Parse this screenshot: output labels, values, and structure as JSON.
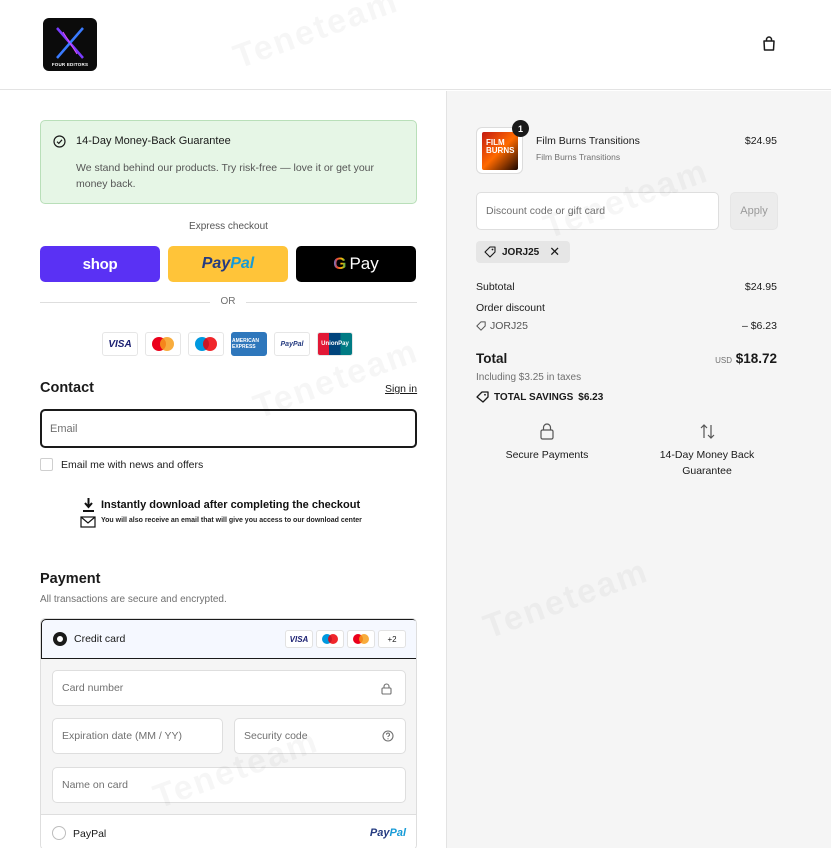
{
  "header": {
    "logo_text": "FOUR EDITORS",
    "cart_icon": "bag-icon"
  },
  "guarantee": {
    "title": "14-Day Money-Back Guarantee",
    "body": "We stand behind our products. Try risk-free — love it or get your money back."
  },
  "express": {
    "label": "Express checkout",
    "shop_label": "shop",
    "paypal_part1": "Pay",
    "paypal_part2": "Pal",
    "gpay_g": "G",
    "gpay_label": "Pay",
    "or_label": "OR"
  },
  "accepted_cards": {
    "visa": "VISA",
    "amex": "AMERICAN EXPRESS",
    "paypal": "PayPal",
    "unionpay": "UnionPay"
  },
  "contact": {
    "title": "Contact",
    "signin": "Sign in",
    "email_placeholder": "Email",
    "newsletter_label": "Email me with news and offers"
  },
  "download_banner": {
    "title": "Instantly download after completing the checkout",
    "subtitle": "You will also receive an email that will give you access to our download center"
  },
  "payment": {
    "title": "Payment",
    "subtitle": "All transactions are secure and encrypted.",
    "credit_card_label": "Credit card",
    "brands_visa": "VISA",
    "brands_more": "+2",
    "card_number_placeholder": "Card number",
    "expiry_placeholder": "Expiration date (MM / YY)",
    "security_placeholder": "Security code",
    "name_placeholder": "Name on card",
    "paypal_label": "PayPal",
    "paypal_logo_1": "Pay",
    "paypal_logo_2": "Pal"
  },
  "order": {
    "quantity": "1",
    "thumb_text": "FILM BURNS",
    "product_name": "Film Burns Transitions",
    "product_variant": "Film Burns Transitions",
    "product_price": "$24.95",
    "discount_placeholder": "Discount code or gift card",
    "apply_label": "Apply",
    "code_chip": "JORJ25",
    "subtotal_label": "Subtotal",
    "subtotal_value": "$24.95",
    "discount_label": "Order discount",
    "discount_code": "JORJ25",
    "discount_value": "– $6.23",
    "total_label": "Total",
    "currency": "USD",
    "total_value": "$18.72",
    "taxes_note": "Including $3.25 in taxes",
    "savings_label": "TOTAL SAVINGS",
    "savings_value": "$6.23"
  },
  "badges": {
    "secure_label": "Secure Payments",
    "guarantee_line1": "14-Day Money Back",
    "guarantee_line2": "Guarantee"
  },
  "watermark": "Teneteam",
  "colors": {
    "shop_purple": "#5a31f4",
    "paypal_yellow": "#ffc439",
    "guarantee_bg": "#e6f6e6",
    "summary_bg": "#f5f5f5"
  }
}
